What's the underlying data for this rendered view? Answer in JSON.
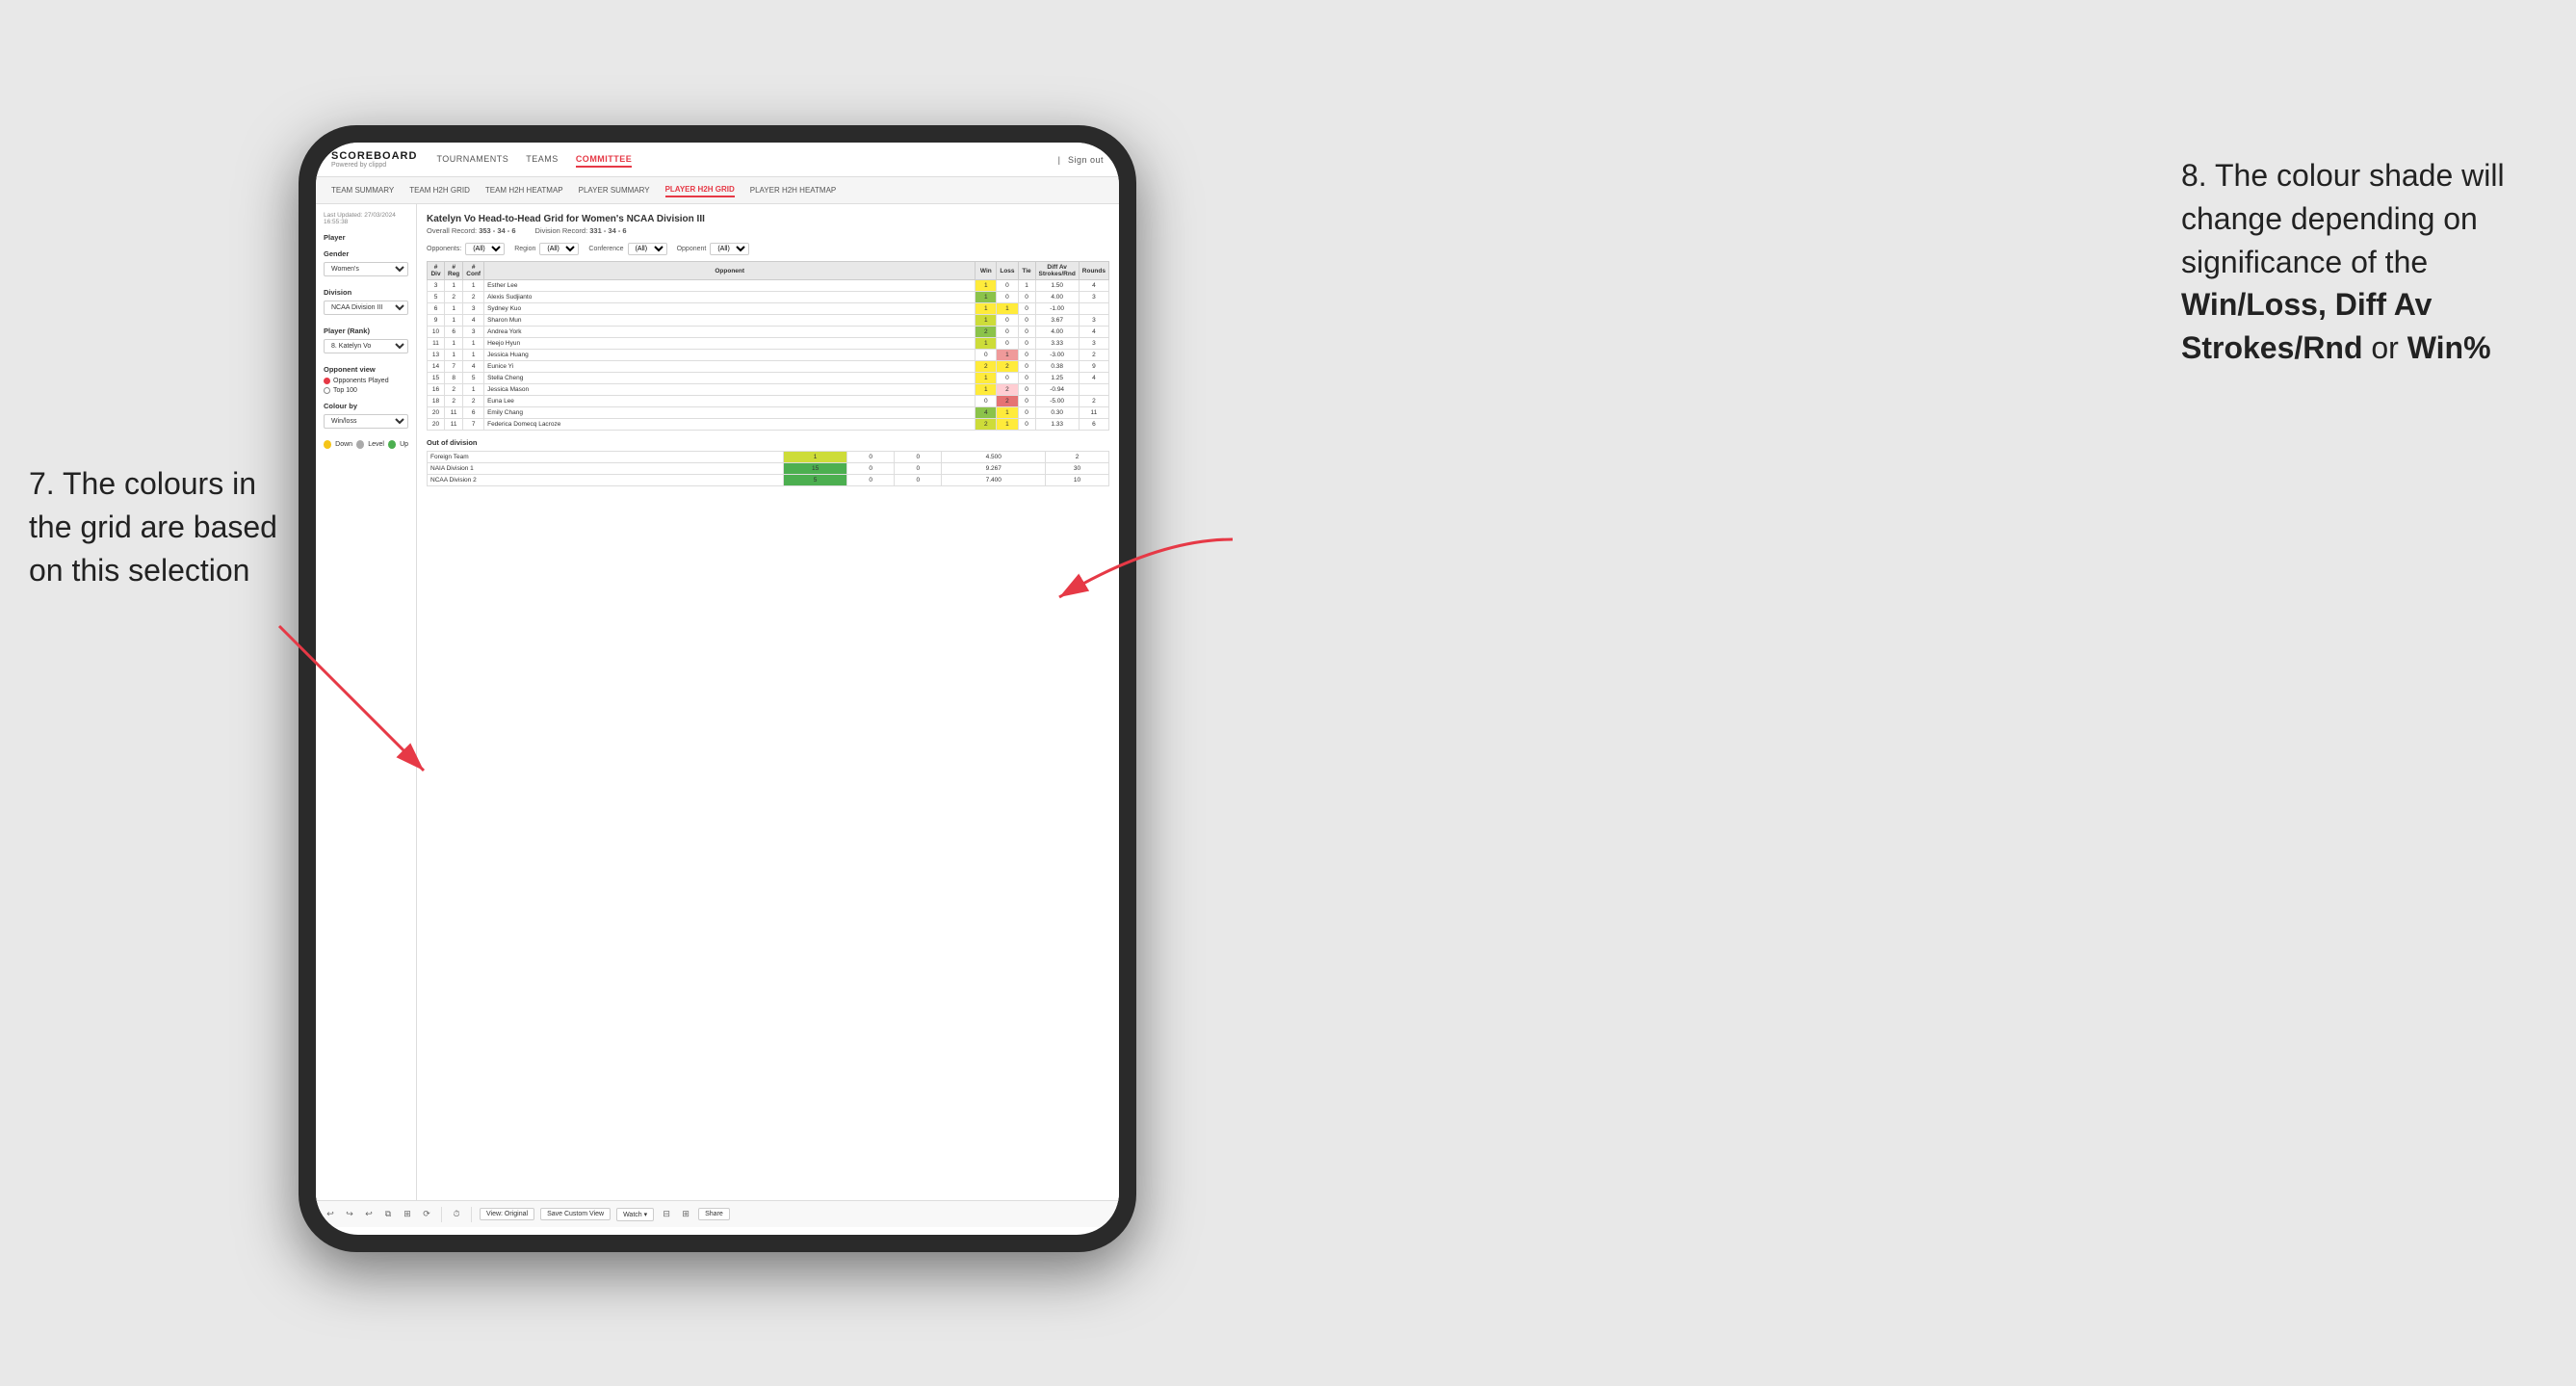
{
  "annotations": {
    "left_text": "7. The colours in the grid are based on this selection",
    "right_text_1": "8. The colour shade will change depending on significance of the ",
    "right_bold": "Win/Loss, Diff Av Strokes/Rnd",
    "right_text_2": " or ",
    "right_bold2": "Win%"
  },
  "nav": {
    "logo_title": "SCOREBOARD",
    "logo_sub": "Powered by clippd",
    "items": [
      "TOURNAMENTS",
      "TEAMS",
      "COMMITTEE"
    ],
    "active": "COMMITTEE",
    "right": [
      "Sign out"
    ]
  },
  "sub_nav": {
    "items": [
      "TEAM SUMMARY",
      "TEAM H2H GRID",
      "TEAM H2H HEATMAP",
      "PLAYER SUMMARY",
      "PLAYER H2H GRID",
      "PLAYER H2H HEATMAP"
    ],
    "active": "PLAYER H2H GRID"
  },
  "left_panel": {
    "last_updated": "Last Updated: 27/03/2024 16:55:38",
    "player_section": "Player",
    "gender_label": "Gender",
    "gender_value": "Women's",
    "division_label": "Division",
    "division_value": "NCAA Division III",
    "player_rank_label": "Player (Rank)",
    "player_rank_value": "8. Katelyn Vo",
    "opponent_view_label": "Opponent view",
    "opponent_options": [
      "Opponents Played",
      "Top 100"
    ],
    "opponent_selected": "Opponents Played",
    "colour_by_label": "Colour by",
    "colour_by_value": "Win/loss",
    "legend": [
      {
        "color": "#f5c518",
        "label": "Down"
      },
      {
        "color": "#aaa",
        "label": "Level"
      },
      {
        "color": "#4caf50",
        "label": "Up"
      }
    ]
  },
  "grid": {
    "title": "Katelyn Vo Head-to-Head Grid for Women's NCAA Division III",
    "overall_record_label": "Overall Record:",
    "overall_record": "353 - 34 - 6",
    "division_record_label": "Division Record:",
    "division_record": "331 - 34 - 6",
    "filters": {
      "opponents_label": "Opponents:",
      "opponents_value": "(All)",
      "region_label": "Region",
      "region_value": "(All)",
      "conference_label": "Conference",
      "conference_value": "(All)",
      "opponent_label": "Opponent",
      "opponent_value": "(All)"
    },
    "table_headers": [
      "#",
      "#",
      "#",
      "Opponent",
      "Win",
      "Loss",
      "Tie",
      "Diff Av Strokes/Rnd",
      "Rounds"
    ],
    "table_sub_headers": [
      "Div",
      "Reg",
      "Conf",
      "",
      "",
      "",
      "",
      "",
      ""
    ],
    "rows": [
      {
        "div": 3,
        "reg": 1,
        "conf": 1,
        "opponent": "Esther Lee",
        "win": 1,
        "loss": 0,
        "tie": 1,
        "diff": 1.5,
        "rounds": 4,
        "win_color": "yellow",
        "loss_color": "white",
        "tie_color": "white"
      },
      {
        "div": 5,
        "reg": 2,
        "conf": 2,
        "opponent": "Alexis Sudjianto",
        "win": 1,
        "loss": 0,
        "tie": 0,
        "diff": 4.0,
        "rounds": 3,
        "win_color": "green",
        "loss_color": "white",
        "tie_color": "white"
      },
      {
        "div": 6,
        "reg": 1,
        "conf": 3,
        "opponent": "Sydney Kuo",
        "win": 1,
        "loss": 1,
        "tie": 0,
        "diff": -1.0,
        "rounds": "",
        "win_color": "yellow",
        "loss_color": "yellow",
        "tie_color": "white"
      },
      {
        "div": 9,
        "reg": 1,
        "conf": 4,
        "opponent": "Sharon Mun",
        "win": 1,
        "loss": 0,
        "tie": 0,
        "diff": 3.67,
        "rounds": 3,
        "win_color": "green-med",
        "loss_color": "white",
        "tie_color": "white"
      },
      {
        "div": 10,
        "reg": 6,
        "conf": 3,
        "opponent": "Andrea York",
        "win": 2,
        "loss": 0,
        "tie": 0,
        "diff": 4.0,
        "rounds": 4,
        "win_color": "green",
        "loss_color": "white",
        "tie_color": "white"
      },
      {
        "div": 11,
        "reg": 1,
        "conf": 1,
        "opponent": "Heejo Hyun",
        "win": 1,
        "loss": 0,
        "tie": 0,
        "diff": 3.33,
        "rounds": 3,
        "win_color": "green-med",
        "loss_color": "white",
        "tie_color": "white"
      },
      {
        "div": 13,
        "reg": 1,
        "conf": 1,
        "opponent": "Jessica Huang",
        "win": 0,
        "loss": 1,
        "tie": 0,
        "diff": -3.0,
        "rounds": 2,
        "win_color": "white",
        "loss_color": "red",
        "tie_color": "white"
      },
      {
        "div": 14,
        "reg": 7,
        "conf": 4,
        "opponent": "Eunice Yi",
        "win": 2,
        "loss": 2,
        "tie": 0,
        "diff": 0.38,
        "rounds": 9,
        "win_color": "yellow",
        "loss_color": "yellow",
        "tie_color": "white"
      },
      {
        "div": 15,
        "reg": 8,
        "conf": 5,
        "opponent": "Stella Cheng",
        "win": 1,
        "loss": 0,
        "tie": 0,
        "diff": 1.25,
        "rounds": 4,
        "win_color": "yellow",
        "loss_color": "white",
        "tie_color": "white"
      },
      {
        "div": 16,
        "reg": 2,
        "conf": 1,
        "opponent": "Jessica Mason",
        "win": 1,
        "loss": 2,
        "tie": 0,
        "diff": -0.94,
        "rounds": "",
        "win_color": "yellow",
        "loss_color": "red-light",
        "tie_color": "white"
      },
      {
        "div": 18,
        "reg": 2,
        "conf": 2,
        "opponent": "Euna Lee",
        "win": 0,
        "loss": 2,
        "tie": 0,
        "diff": -5.0,
        "rounds": 2,
        "win_color": "white",
        "loss_color": "red-dark",
        "tie_color": "white"
      },
      {
        "div": 20,
        "reg": 11,
        "conf": 6,
        "opponent": "Emily Chang",
        "win": 4,
        "loss": 1,
        "tie": 0,
        "diff": 0.3,
        "rounds": 11,
        "win_color": "green-med",
        "loss_color": "yellow",
        "tie_color": "white"
      },
      {
        "div": 20,
        "reg": 11,
        "conf": 7,
        "opponent": "Federica Domecq Lacroze",
        "win": 2,
        "loss": 1,
        "tie": 0,
        "diff": 1.33,
        "rounds": 6,
        "win_color": "green-light",
        "loss_color": "yellow",
        "tie_color": "white"
      }
    ],
    "out_of_division_label": "Out of division",
    "out_of_division_rows": [
      {
        "opponent": "Foreign Team",
        "win": 1,
        "loss": 0,
        "tie": 0,
        "diff": 4.5,
        "rounds": 2,
        "win_color": "green"
      },
      {
        "opponent": "NAIA Division 1",
        "win": 15,
        "loss": 0,
        "tie": 0,
        "diff": 9.267,
        "rounds": 30,
        "win_color": "green-dark"
      },
      {
        "opponent": "NCAA Division 2",
        "win": 5,
        "loss": 0,
        "tie": 0,
        "diff": 7.4,
        "rounds": 10,
        "win_color": "green-dark"
      }
    ]
  },
  "toolbar": {
    "buttons": [
      "View: Original",
      "Save Custom View",
      "Watch",
      "Share"
    ],
    "icons": [
      "undo",
      "redo",
      "undo2",
      "copy",
      "paste",
      "refresh",
      "clock"
    ]
  }
}
